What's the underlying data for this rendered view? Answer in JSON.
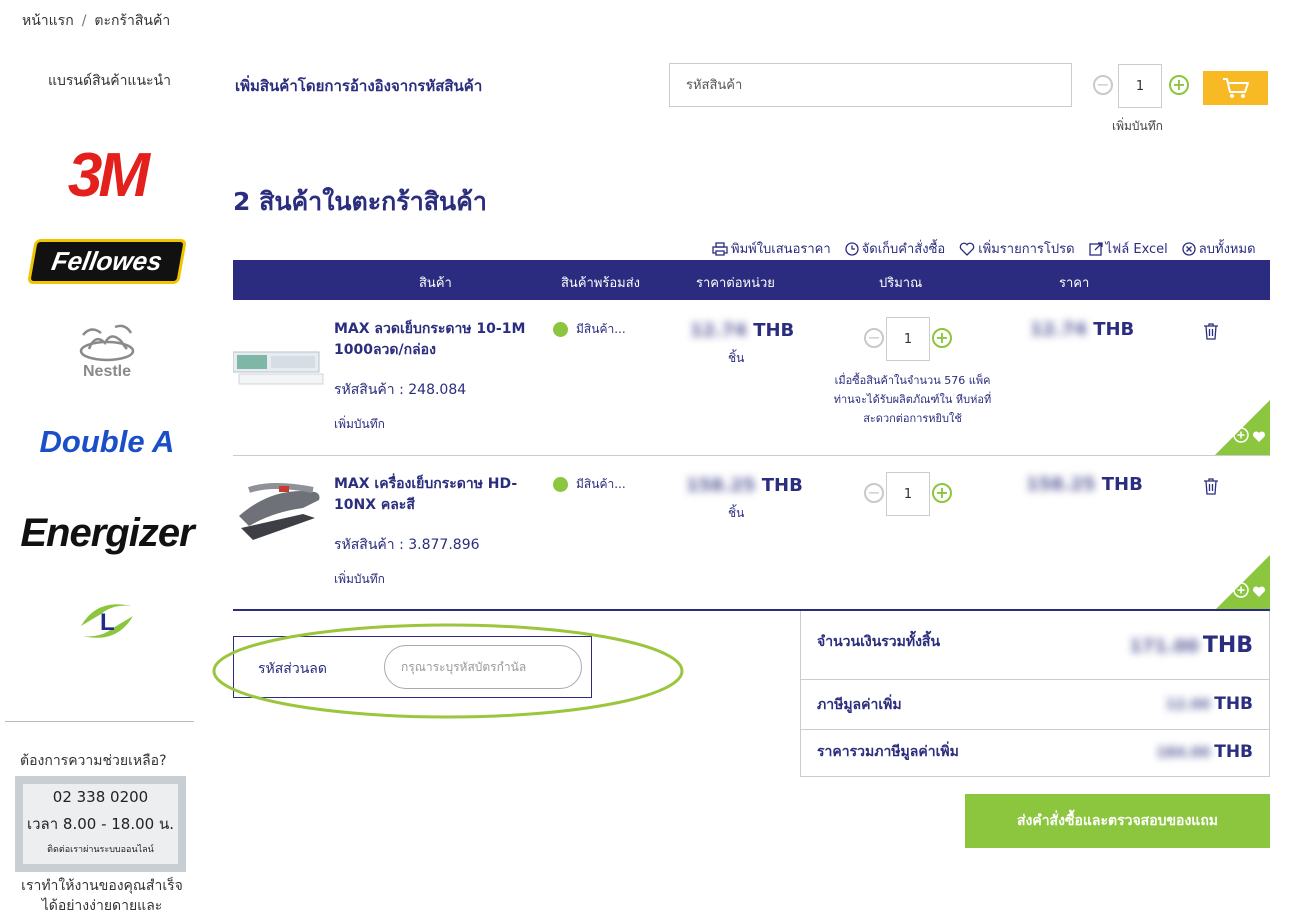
{
  "breadcrumb": {
    "home": "หน้าแรก",
    "separator": "/",
    "current": "ตะกร้าสินค้า"
  },
  "sidebar": {
    "brands_title": "แบรนด์สินค้าแนะนำ",
    "brands": [
      {
        "name": "3M",
        "logo_text": "3M",
        "color": "#e3201b"
      },
      {
        "name": "Fellowes",
        "logo_text": "Fellowes"
      },
      {
        "name": "Nestlé",
        "logo_text": "Nestle"
      },
      {
        "name": "Double A",
        "logo_text": "Double A",
        "color": "#1a4fc8"
      },
      {
        "name": "Energizer",
        "logo_text": "Energizer"
      },
      {
        "name": "Lyreco",
        "logo_text": "L"
      }
    ],
    "help_title": "ต้องการความช่วยเหลือ?",
    "help_phone": "02 338 0200",
    "help_hours": "เวลา 8.00 - 18.00 น.",
    "help_online": "ติดต่อเราผ่านระบบออนไลน์",
    "help_tagline": "เราทำให้งานของคุณสำเร็จได้อย่างง่ายดายและ"
  },
  "add_by_code": {
    "label": "เพิ่มสินค้าโดยการอ้างอิงจากรหัสสินค้า",
    "placeholder": "รหัสสินค้า",
    "quantity": "1",
    "note_link": "เพิ่มบันทึก",
    "cart_icon": "cart-icon",
    "button_color": "#f7b924"
  },
  "cart": {
    "heading": "2 สินค้าในตะกร้าสินค้า",
    "actions": [
      {
        "icon": "printer-icon",
        "label": "พิมพ์ใบเสนอราคา"
      },
      {
        "icon": "clock-icon",
        "label": "จัดเก็บคำสั่งซื้อ"
      },
      {
        "icon": "heart-icon",
        "label": "เพิ่มรายการโปรด"
      },
      {
        "icon": "export-icon",
        "label": "ไฟล์ Excel"
      },
      {
        "icon": "close-circle-icon",
        "label": "ลบทั้งหมด"
      }
    ],
    "columns": {
      "product": "สินค้า",
      "availability": "สินค้าพร้อมส่ง",
      "unit_price": "ราคาต่อหน่วย",
      "quantity": "ปริมาณ",
      "price": "ราคา"
    },
    "header_color": "#2b2c7f",
    "items": [
      {
        "name": "MAX ลวดเย็บกระดาษ 10-1M 1000ลวด/กล่อง",
        "sku": "รหัสสินค้า : 248.084",
        "note_link": "เพิ่มบันทึก",
        "availability": "มีสินค้า...",
        "unit_price_blurred": "12.74",
        "currency": "THB",
        "unit": "ชิ้น",
        "quantity": "1",
        "promo_note": "เมื่อซื้อสินค้าในจำนวน 576 แพ็ค ท่านจะได้รับผลิตภัณฑ์ใน หีบห่อที่สะดวกต่อการหยิบใช้",
        "total_blurred": "12.74",
        "total_currency": "THB"
      },
      {
        "name": "MAX เครื่องเย็บกระดาษ HD-10NX คละสี",
        "sku": "รหัสสินค้า : 3.877.896",
        "note_link": "เพิ่มบันทึก",
        "availability": "มีสินค้า...",
        "unit_price_blurred": "158.25",
        "currency": "THB",
        "unit": "ชิ้น",
        "quantity": "1",
        "total_blurred": "158.25",
        "total_currency": "THB"
      }
    ]
  },
  "discount": {
    "label": "รหัสส่วนลด",
    "placeholder": "กรุณาระบุรหัสบัตรกำนัล",
    "highlight_color": "#9bc53d"
  },
  "summary": {
    "total_label": "จำนวนเงินรวมทั้งสิ้น",
    "total_blurred": "171.00",
    "total_currency": "THB",
    "vat_label": "ภาษีมูลค่าเพิ่ม",
    "vat_blurred": "12.00",
    "vat_currency": "THB",
    "ex_vat_label": "ราคารวมภาษีมูลค่าเพิ่ม",
    "ex_vat_blurred": "184.00",
    "ex_vat_currency": "THB"
  },
  "checkout": {
    "label": "ส่งคำสั่งซื้อและตรวจสอบของแถม",
    "color": "#8cc63e"
  }
}
